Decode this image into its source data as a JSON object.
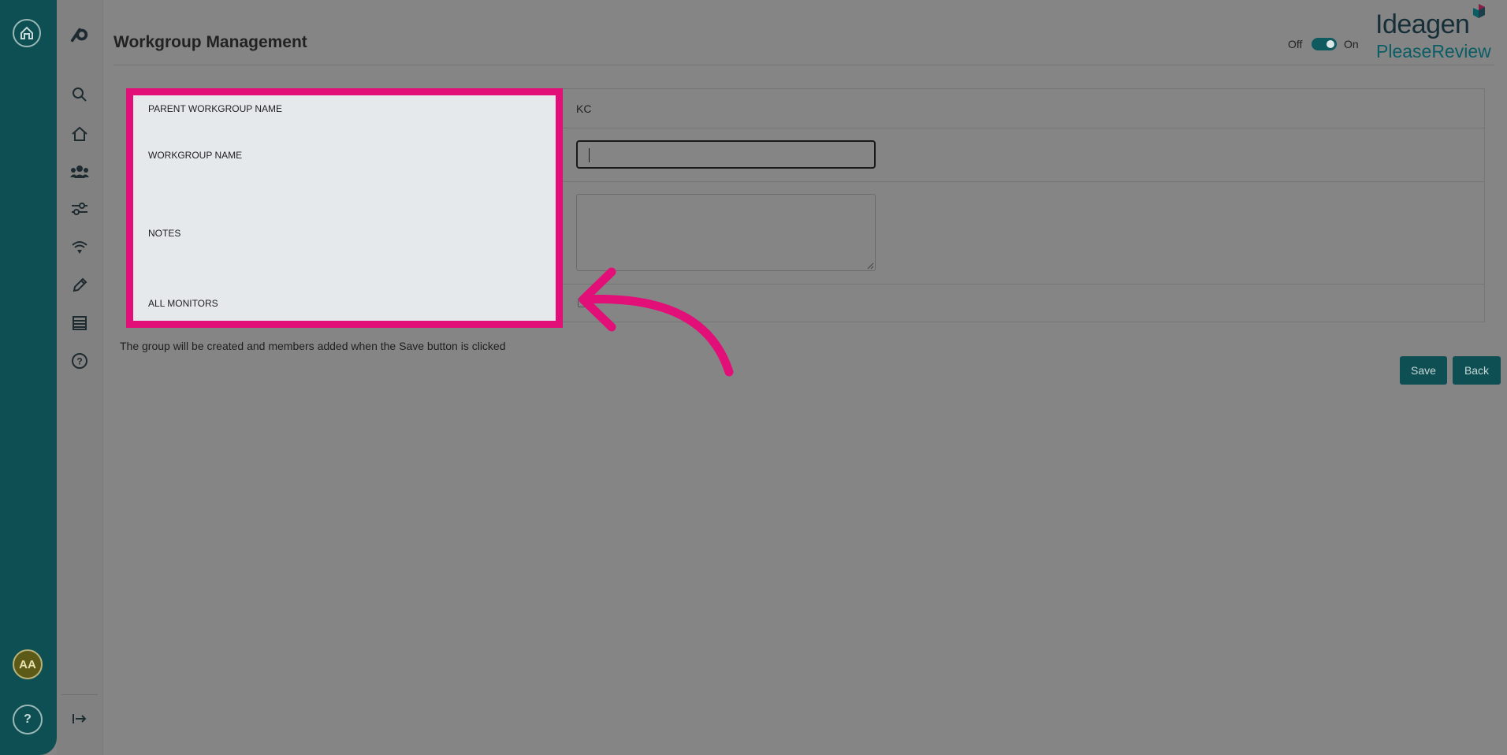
{
  "header": {
    "title": "Workgroup Management",
    "toggle": {
      "off_label": "Off",
      "on_label": "On",
      "state": "on"
    },
    "brand": {
      "line1": "Ideagen",
      "line2": "PleaseReview"
    }
  },
  "rail": {
    "avatar_initials": "AA",
    "help_label": "?"
  },
  "nav": {
    "items": [
      "search-icon",
      "home-icon",
      "users-icon",
      "sliders-icon",
      "signal-icon",
      "edit-icon",
      "list-icon",
      "help-circle-icon"
    ],
    "collapse_icon": "expand-arrow-icon"
  },
  "form": {
    "labels": {
      "parent_workgroup": "PARENT WORKGROUP NAME",
      "workgroup_name": "WORKGROUP NAME",
      "notes": "NOTES",
      "all_monitors": "ALL MONITORS"
    },
    "values": {
      "parent_workgroup": "KC",
      "workgroup_name": "",
      "notes": "",
      "all_monitors_checked": false
    }
  },
  "info_text": "The group will be created and members added when the Save button is clicked",
  "buttons": {
    "save": "Save",
    "back": "Back"
  },
  "colors": {
    "overlay": "#858585",
    "rail": "#0d4f52",
    "highlight": "#e20f78",
    "panel": "#e6e9ec",
    "button": "#0d4f52"
  }
}
